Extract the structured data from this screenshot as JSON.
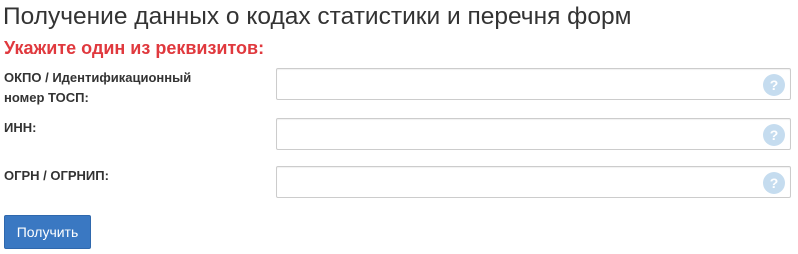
{
  "page": {
    "title": "Получение данных о кодах статистики и перечня форм",
    "hint": "Укажите один из реквизитов:"
  },
  "fields": [
    {
      "label_line1": "ОКПО / Идентификационный",
      "label_line2": "номер ТОСП:",
      "value": "",
      "placeholder": "",
      "help_icon": "question-icon",
      "help_glyph": "?"
    },
    {
      "label_line1": "ИНН:",
      "value": "",
      "placeholder": "",
      "help_icon": "question-icon",
      "help_glyph": "?"
    },
    {
      "label_line1": "ОГРН / ОГРНИП:",
      "value": "",
      "placeholder": "",
      "help_icon": "question-icon",
      "help_glyph": "?"
    }
  ],
  "actions": {
    "submit_label": "Получить"
  },
  "colors": {
    "hint": "#e0393e",
    "button": "#3a78c2",
    "help_icon": "#c5dcef",
    "text": "#333333"
  }
}
